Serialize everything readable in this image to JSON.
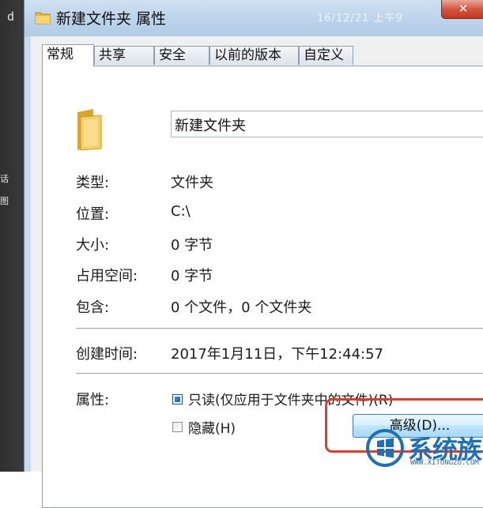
{
  "background": {
    "fragments": [
      "d",
      "话",
      "图"
    ]
  },
  "window": {
    "title": "新建文件夹 属性",
    "title_ghost": "16/12/21 上午9",
    "close_label": "✕"
  },
  "tabs": [
    {
      "label": "常规",
      "active": true
    },
    {
      "label": "共享",
      "active": false
    },
    {
      "label": "安全",
      "active": false
    },
    {
      "label": "以前的版本",
      "active": false
    },
    {
      "label": "自定义",
      "active": false
    }
  ],
  "general": {
    "folder_icon": "folder-icon",
    "name_value": "新建文件夹",
    "rows": {
      "type": {
        "label": "类型:",
        "value": "文件夹"
      },
      "location": {
        "label": "位置:",
        "value": "C:\\"
      },
      "size": {
        "label": "大小:",
        "value": "0 字节"
      },
      "size_on_disk": {
        "label": "占用空间:",
        "value": "0 字节"
      },
      "contains": {
        "label": "包含:",
        "value": "0 个文件，0 个文件夹"
      },
      "created": {
        "label": "创建时间:",
        "value": "2017年1月11日，下午12:44:57"
      }
    },
    "attributes": {
      "label": "属性:",
      "readonly": {
        "label": "只读(仅应用于文件夹中的文件)(R)",
        "checked": "indeterminate"
      },
      "hidden": {
        "label": "隐藏(H)",
        "checked": false
      },
      "advanced_button": "高级(D)..."
    }
  },
  "watermark": {
    "text": "系统族",
    "sub": "WWW.XITONGZU.COM"
  },
  "colors": {
    "title_bar": "#bcd3ea",
    "close_button": "#c4381f",
    "highlight": "#e03c2c",
    "watermark": "#1f6fb7"
  }
}
